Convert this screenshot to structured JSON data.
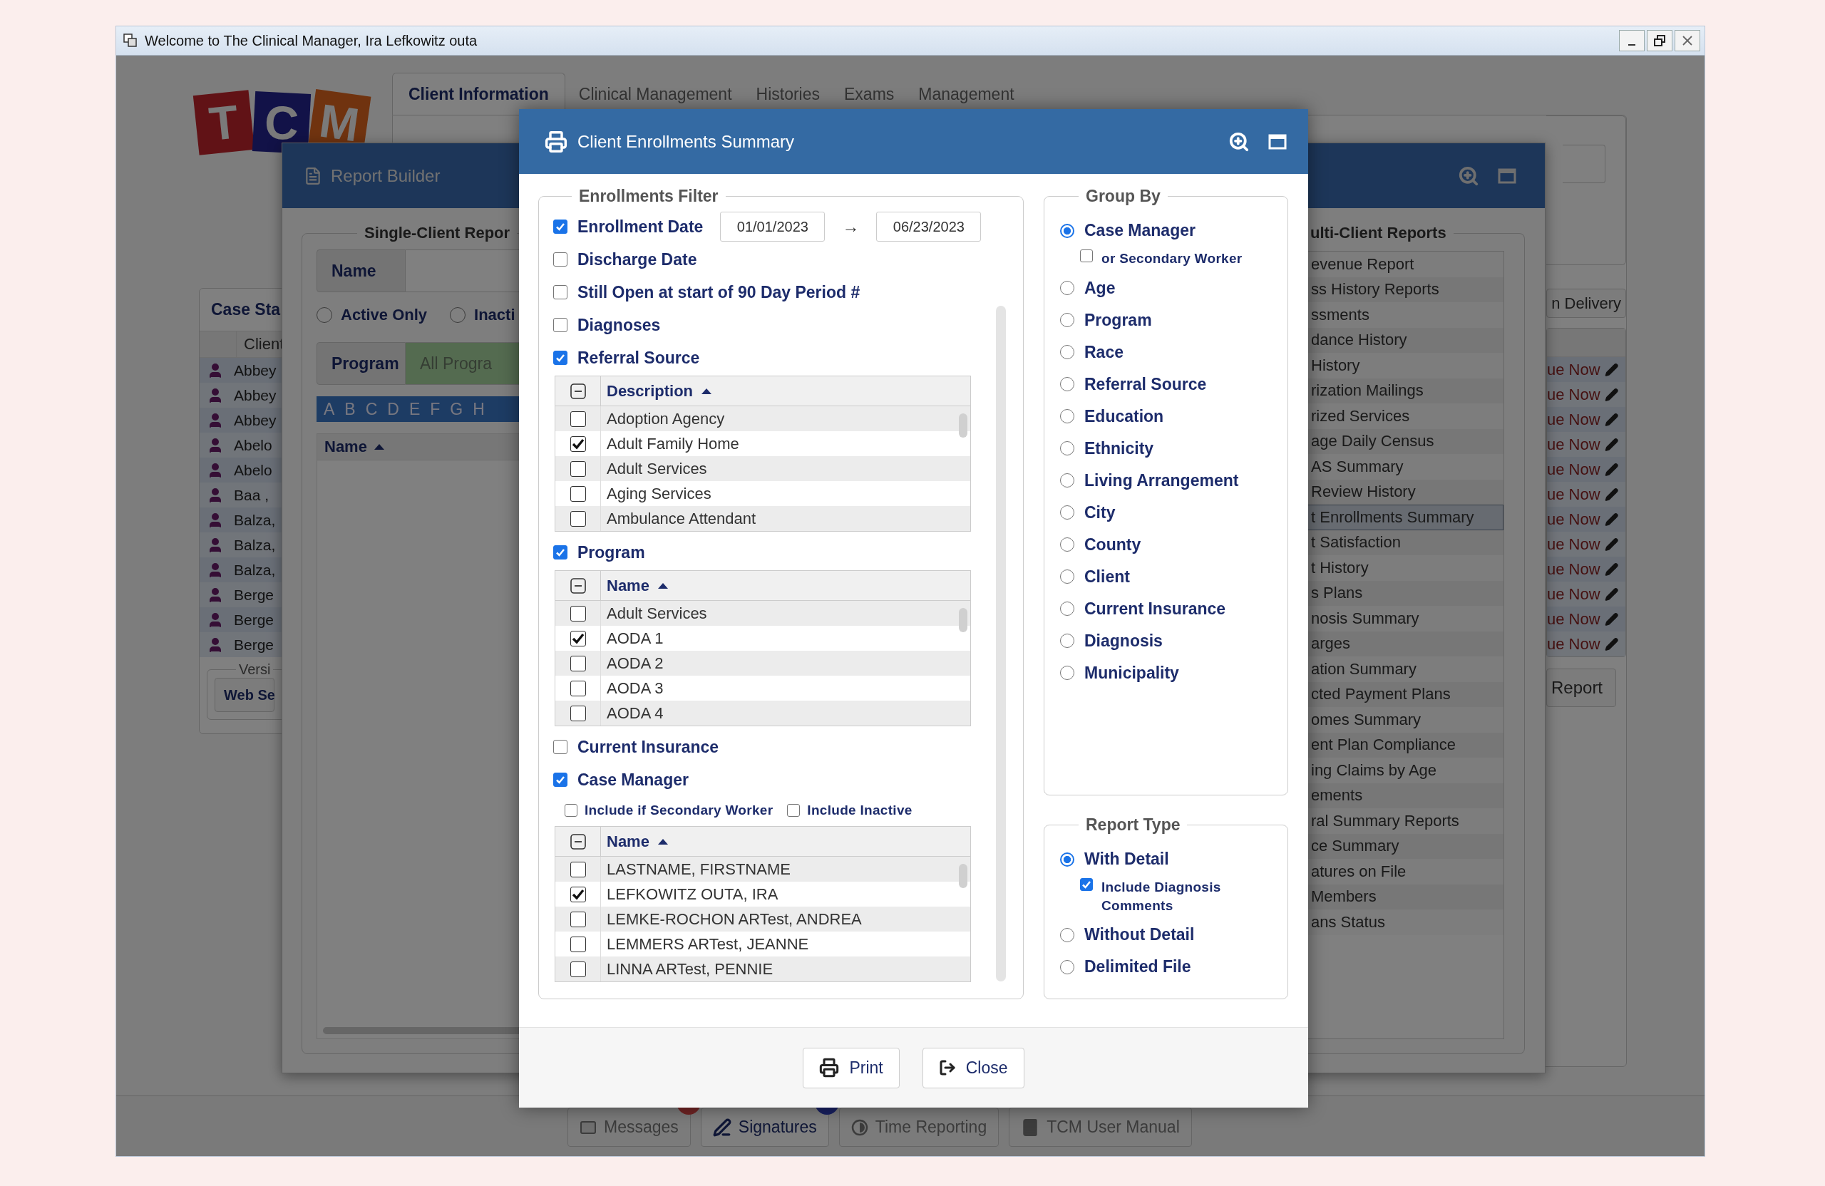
{
  "title_bar": {
    "title": "Welcome to The Clinical Manager, Ira Lefkowitz outa"
  },
  "main": {
    "logo": [
      "T",
      "C",
      "M"
    ],
    "tabs": [
      {
        "label": "Client Information",
        "selected": true
      },
      {
        "label": "Clinical Management",
        "selected": false
      },
      {
        "label": "Histories",
        "selected": false
      },
      {
        "label": "Exams",
        "selected": false
      },
      {
        "label": "Management",
        "selected": false
      }
    ],
    "case_status": {
      "title": "Case Sta",
      "column": "Client",
      "rows": [
        "Abbey",
        "Abbey",
        "Abbey",
        "Abelo",
        "Abelo",
        "Baa ,",
        "Balza,",
        "Balza,",
        "Balza,",
        "Berge",
        "Berge",
        "Berge"
      ],
      "version_legend": "Versi",
      "button": "Web Se"
    },
    "right_panel": {
      "button": "n Delivery",
      "rows": [
        "ue Now",
        "ue Now",
        "ue Now",
        "ue Now",
        "ue Now",
        "ue Now",
        "ue Now",
        "ue Now",
        "ue Now",
        "ue Now",
        "ue Now",
        "ue Now"
      ],
      "report_button": "Report"
    },
    "bottom_tabs": [
      {
        "label": "Messages",
        "kind": "envelope",
        "selected": false,
        "badge": true
      },
      {
        "label": "Signatures",
        "kind": "signature",
        "selected": true,
        "badge": true
      },
      {
        "label": "Time Reporting",
        "kind": "clock",
        "selected": false,
        "badge": false
      },
      {
        "label": "TCM User Manual",
        "kind": "book",
        "selected": false,
        "badge": false
      }
    ]
  },
  "report_builder": {
    "title": "Report Builder",
    "single": {
      "legend": "Single-Client Repor",
      "name_label": "Name",
      "filters": [
        {
          "label": "Active Only",
          "selected": false
        },
        {
          "label": "Inacti",
          "selected": false
        }
      ],
      "program_label": "Program",
      "program_value": "All Progra",
      "letters": [
        "A",
        "B",
        "C",
        "D",
        "E",
        "F",
        "G",
        "H"
      ],
      "list_header": "Name"
    },
    "multi": {
      "legend": "ulti-Client Reports",
      "items": [
        {
          "label": "evenue Report",
          "selected": false
        },
        {
          "label": "ss History Reports",
          "selected": false
        },
        {
          "label": "ssments",
          "selected": false
        },
        {
          "label": "dance History",
          "selected": false
        },
        {
          "label": "History",
          "selected": false
        },
        {
          "label": "rization Mailings",
          "selected": false
        },
        {
          "label": "rized Services",
          "selected": false
        },
        {
          "label": "age Daily Census",
          "selected": false
        },
        {
          "label": "AS Summary",
          "selected": false
        },
        {
          "label": "Review History",
          "selected": false
        },
        {
          "label": "t Enrollments Summary",
          "selected": true
        },
        {
          "label": "t Satisfaction",
          "selected": false
        },
        {
          "label": "t History",
          "selected": false
        },
        {
          "label": "s Plans",
          "selected": false
        },
        {
          "label": "nosis Summary",
          "selected": false
        },
        {
          "label": "arges",
          "selected": false
        },
        {
          "label": "ation Summary",
          "selected": false
        },
        {
          "label": "cted Payment Plans",
          "selected": false
        },
        {
          "label": "omes Summary",
          "selected": false
        },
        {
          "label": "ent Plan Compliance",
          "selected": false
        },
        {
          "label": "ing Claims by Age",
          "selected": false
        },
        {
          "label": "ements",
          "selected": false
        },
        {
          "label": "ral Summary Reports",
          "selected": false
        },
        {
          "label": "ce Summary",
          "selected": false
        },
        {
          "label": "atures on File",
          "selected": false
        },
        {
          "label": "Members",
          "selected": false
        },
        {
          "label": "ans Status",
          "selected": false
        }
      ]
    }
  },
  "modal": {
    "title": "Client Enrollments Summary",
    "filter": {
      "legend": "Enrollments Filter",
      "items": [
        {
          "kind": "date_range",
          "label": "Enrollment Date",
          "checked": true,
          "from": "01/01/2023",
          "arrow": "→",
          "to": "06/23/2023"
        },
        {
          "kind": "check",
          "label": "Discharge Date",
          "checked": false
        },
        {
          "kind": "check",
          "label": "Still Open at start of 90 Day Period #",
          "checked": false
        },
        {
          "kind": "check",
          "label": "Diagnoses",
          "checked": false
        },
        {
          "kind": "check",
          "label": "Referral Source",
          "checked": true
        },
        {
          "kind": "grid",
          "header": "Description",
          "rows": [
            {
              "label": "Adoption Agency",
              "checked": false
            },
            {
              "label": "Adult Family Home",
              "checked": true
            },
            {
              "label": "Adult Services",
              "checked": false
            },
            {
              "label": "Aging Services",
              "checked": false
            },
            {
              "label": "Ambulance Attendant",
              "checked": false
            }
          ]
        },
        {
          "kind": "check",
          "label": "Program",
          "checked": true
        },
        {
          "kind": "grid",
          "header": "Name",
          "rows": [
            {
              "label": "Adult Services",
              "checked": false
            },
            {
              "label": "AODA 1",
              "checked": true
            },
            {
              "label": "AODA 2",
              "checked": false
            },
            {
              "label": "AODA 3",
              "checked": false
            },
            {
              "label": "AODA 4",
              "checked": false
            }
          ]
        },
        {
          "kind": "check",
          "label": "Current Insurance",
          "checked": false
        },
        {
          "kind": "check",
          "label": "Case Manager",
          "checked": true
        },
        {
          "kind": "options",
          "options": [
            {
              "label": "Include if Secondary Worker",
              "checked": false
            },
            {
              "label": "Include Inactive",
              "checked": false
            }
          ]
        },
        {
          "kind": "grid",
          "header": "Name",
          "rows": [
            {
              "label": "LASTNAME, FIRSTNAME",
              "checked": false
            },
            {
              "label": "LEFKOWITZ OUTA, IRA",
              "checked": true
            },
            {
              "label": "LEMKE-ROCHON ARTest, ANDREA",
              "checked": false
            },
            {
              "label": "LEMMERS ARTest, JEANNE",
              "checked": false
            },
            {
              "label": "LINNA ARTest, PENNIE",
              "checked": false
            }
          ]
        }
      ]
    },
    "group_by": {
      "legend": "Group By",
      "options": [
        {
          "label": "Case Manager",
          "selected": true,
          "sub": {
            "label": "or Secondary Worker",
            "checked": false
          }
        },
        {
          "label": "Age",
          "selected": false
        },
        {
          "label": "Program",
          "selected": false
        },
        {
          "label": "Race",
          "selected": false
        },
        {
          "label": "Referral Source",
          "selected": false
        },
        {
          "label": "Education",
          "selected": false
        },
        {
          "label": "Ethnicity",
          "selected": false
        },
        {
          "label": "Living Arrangement",
          "selected": false
        },
        {
          "label": "City",
          "selected": false
        },
        {
          "label": "County",
          "selected": false
        },
        {
          "label": "Client",
          "selected": false
        },
        {
          "label": "Current Insurance",
          "selected": false
        },
        {
          "label": "Diagnosis",
          "selected": false
        },
        {
          "label": "Municipality",
          "selected": false
        }
      ]
    },
    "report_type": {
      "legend": "Report Type",
      "options": [
        {
          "label": "With Detail",
          "selected": true,
          "sub": {
            "label": "Include Diagnosis Comments",
            "checked": true
          }
        },
        {
          "label": "Without Detail",
          "selected": false
        },
        {
          "label": "Delimited File",
          "selected": false
        }
      ]
    },
    "buttons": [
      {
        "label": "Print",
        "kind": "print"
      },
      {
        "label": "Close",
        "kind": "close"
      }
    ]
  }
}
